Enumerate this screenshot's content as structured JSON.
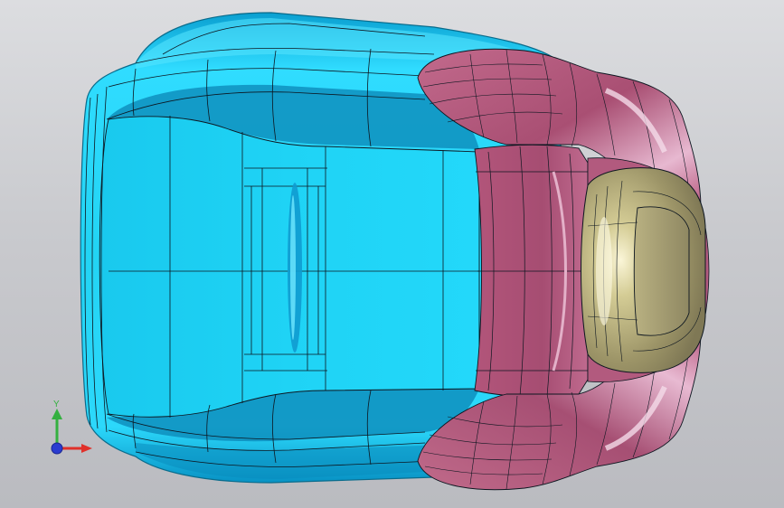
{
  "viewport": {
    "background_top": "#dcdde0",
    "background_bottom": "#babbc0"
  },
  "model": {
    "shell_color": "#1fd0f0",
    "shell_edge_color": "#0a7fa0",
    "bolster_color": "#b0587a",
    "headrest_color": "#a8a070",
    "wire_color": "#0d1620"
  },
  "triad": {
    "y_label": "Y",
    "x_color": "#e0302a",
    "y_color": "#34b040",
    "z_color": "#2a3cd0"
  }
}
